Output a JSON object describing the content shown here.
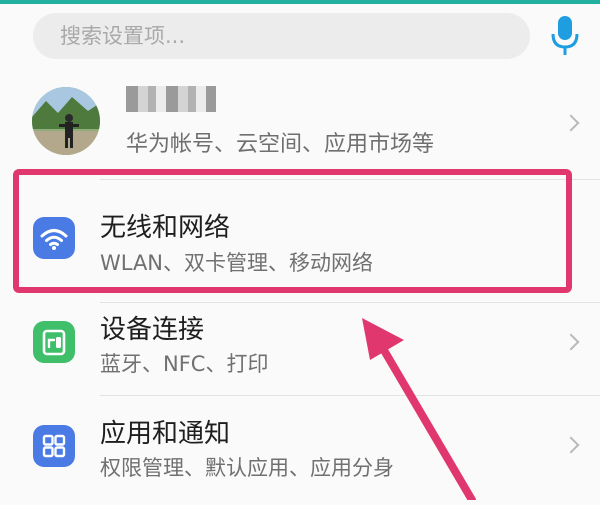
{
  "search": {
    "placeholder": "搜索设置项..."
  },
  "account": {
    "subtitle": "华为帐号、云空间、应用市场等"
  },
  "settings_items": [
    {
      "title": "无线和网络",
      "subtitle": "WLAN、双卡管理、移动网络",
      "icon": "wifi-icon",
      "color": "#4a7be5"
    },
    {
      "title": "设备连接",
      "subtitle": "蓝牙、NFC、打印",
      "icon": "device-connect-icon",
      "color": "#3fbf6a"
    },
    {
      "title": "应用和通知",
      "subtitle": "权限管理、默认应用、应用分身",
      "icon": "apps-grid-icon",
      "color": "#4a7be5"
    }
  ],
  "colors": {
    "accent": "#1e9de0",
    "highlight": "#e0386e",
    "topline": "#22b0a0"
  }
}
